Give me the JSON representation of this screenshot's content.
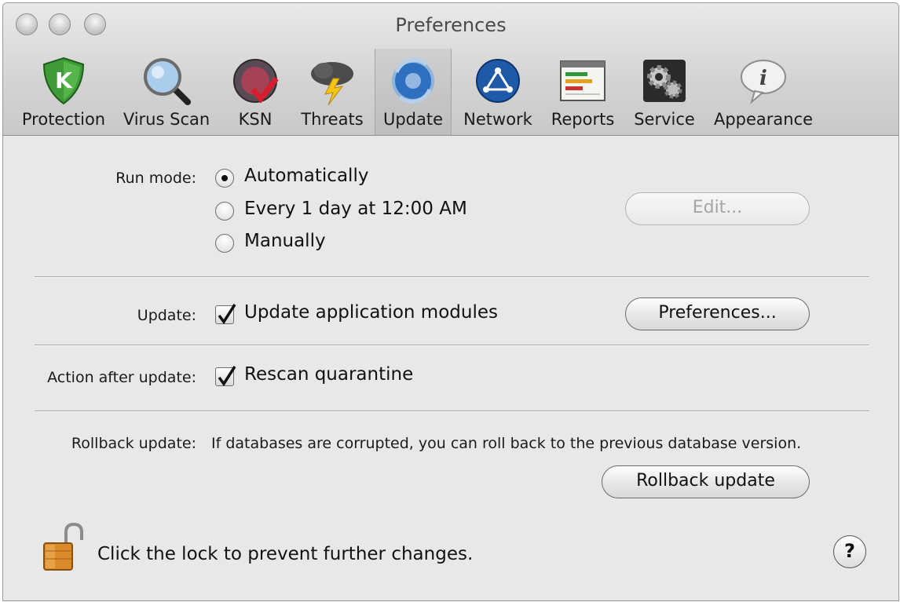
{
  "window": {
    "title": "Preferences"
  },
  "toolbar": {
    "items": [
      {
        "label": "Protection",
        "icon": "shield-k-icon"
      },
      {
        "label": "Virus Scan",
        "icon": "magnifier-icon"
      },
      {
        "label": "KSN",
        "icon": "ksn-globe-icon"
      },
      {
        "label": "Threats",
        "icon": "storm-cloud-icon"
      },
      {
        "label": "Update",
        "icon": "update-globe-icon",
        "selected": true
      },
      {
        "label": "Network",
        "icon": "network-globe-icon"
      },
      {
        "label": "Reports",
        "icon": "reports-icon"
      },
      {
        "label": "Service",
        "icon": "gears-icon"
      },
      {
        "label": "Appearance",
        "icon": "info-bubble-icon"
      }
    ]
  },
  "run_mode": {
    "label": "Run mode:",
    "options": [
      "Automatically",
      "Every 1 day at 12:00 AM",
      "Manually"
    ],
    "selected": "Automatically",
    "edit_button": "Edit..."
  },
  "update": {
    "label": "Update:",
    "checkbox": "Update application modules",
    "checked": true,
    "preferences_button": "Preferences..."
  },
  "action_after_update": {
    "label": "Action after update:",
    "checkbox": "Rescan quarantine",
    "checked": true
  },
  "rollback": {
    "label": "Rollback update:",
    "description": "If databases are corrupted, you can roll back to the previous database version.",
    "button": "Rollback update"
  },
  "lock": {
    "text": "Click the lock to prevent further changes."
  },
  "help": {
    "label": "?"
  }
}
